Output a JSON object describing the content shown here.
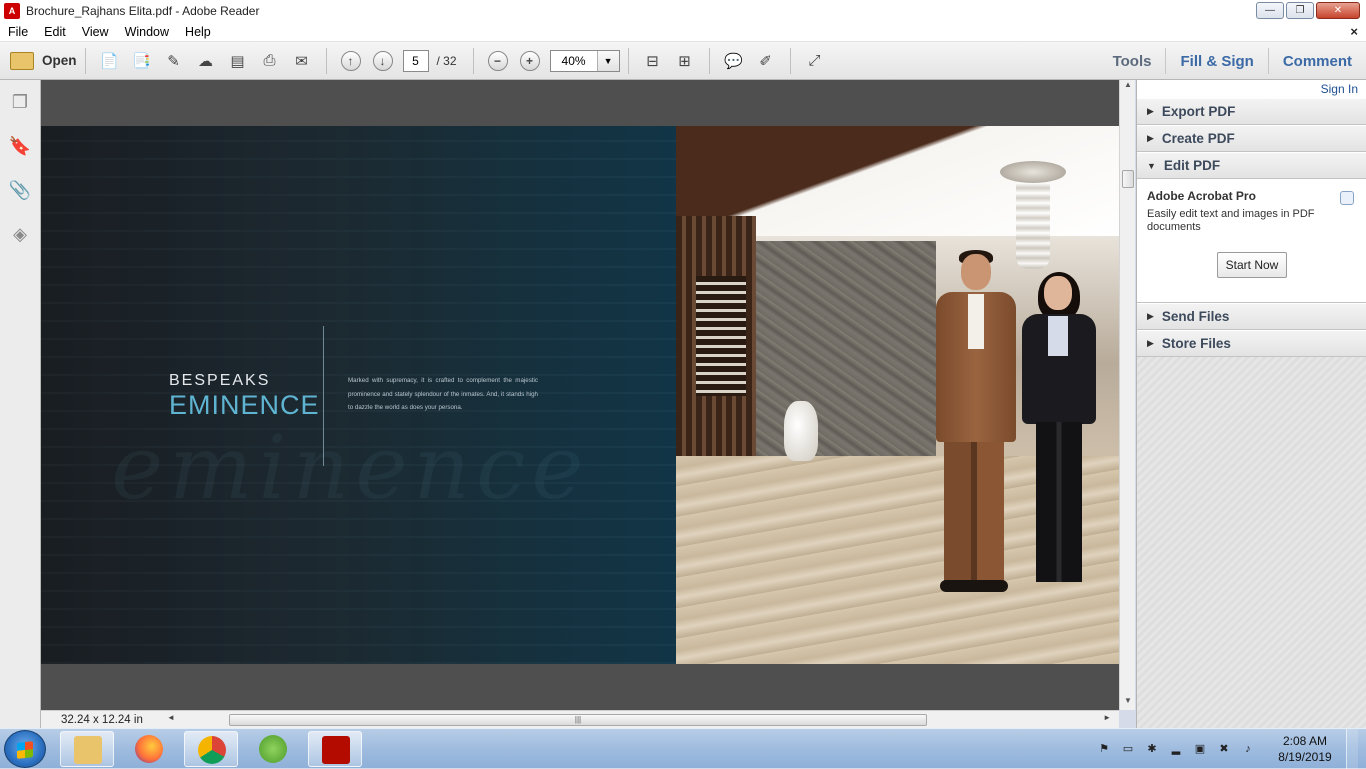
{
  "window": {
    "title": "Brochure_Rajhans Elita.pdf - Adobe Reader",
    "controls": {
      "minimize": "—",
      "maximize": "❐",
      "close": "✕"
    }
  },
  "menu": {
    "items": [
      "File",
      "Edit",
      "View",
      "Window",
      "Help"
    ],
    "doc_close": "×"
  },
  "toolbar": {
    "open_label": "Open",
    "current_page": "5",
    "total_pages": "/ 32",
    "zoom": "40%",
    "right_tabs": [
      "Tools",
      "Fill & Sign",
      "Comment"
    ]
  },
  "document": {
    "left_page": {
      "heading_line1": "BESPEAKS",
      "heading_line2": "EMINENCE",
      "body": "Marked with supremacy, it is crafted to complement the majestic prominence and stately splendour of the inmates. And, it stands high to dazzle the world as does your persona.",
      "script_watermark": "eminence"
    }
  },
  "status": {
    "page_size": "32.24 x 12.24 in"
  },
  "right_panel": {
    "sign_in": "Sign In",
    "sections": {
      "export_pdf": "Export PDF",
      "create_pdf": "Create PDF",
      "edit_pdf": "Edit PDF",
      "send_files": "Send Files",
      "store_files": "Store Files"
    },
    "edit_pdf_body": {
      "product": "Adobe Acrobat Pro",
      "description": "Easily edit text and images in PDF documents",
      "button": "Start Now"
    }
  },
  "taskbar": {
    "apps": [
      "file-explorer",
      "firefox",
      "chrome",
      "utorrent",
      "adobe-reader"
    ],
    "clock_time": "2:08 AM",
    "clock_date": "8/19/2019"
  },
  "colors": {
    "accent_blue": "#3b6aa6",
    "eminence_teal": "#5fb4d2",
    "panel_link": "#1d4f91"
  }
}
